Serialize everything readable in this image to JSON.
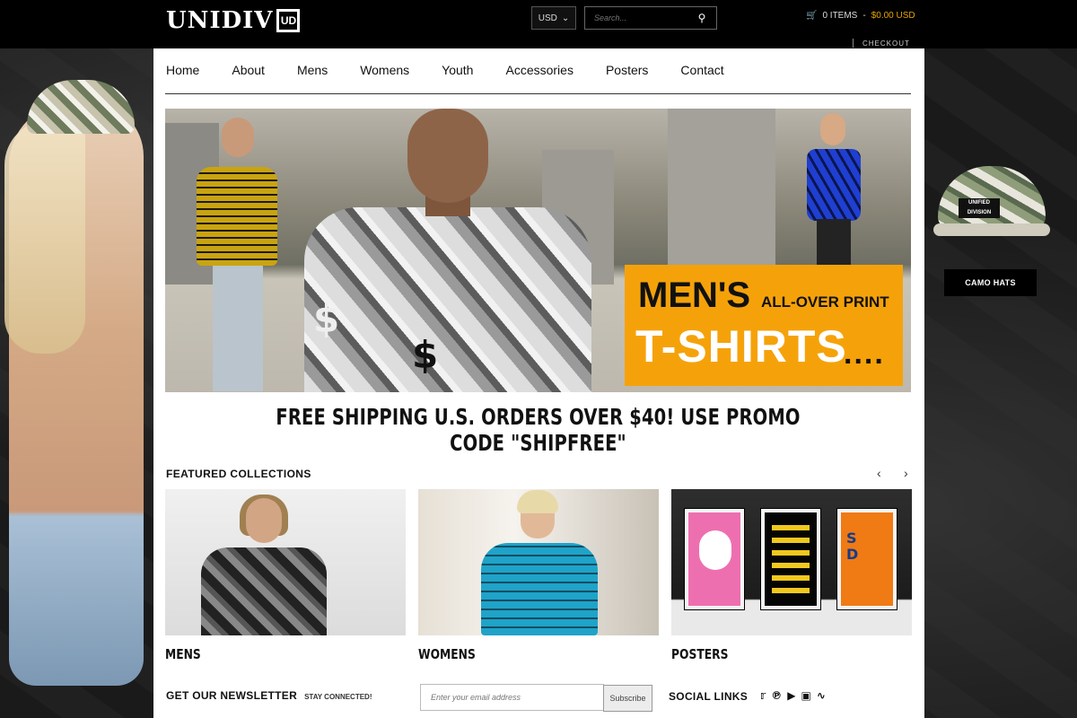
{
  "header": {
    "logo_text": "UNIDIV",
    "logo_mark": "UD",
    "currency": "USD",
    "search_placeholder": "Search...",
    "cart_items": "0 ITEMS",
    "cart_sep": "-",
    "cart_total": "$0.00 USD",
    "checkout": "CHECKOUT"
  },
  "nav": {
    "items": [
      "Home",
      "About",
      "Mens",
      "Womens",
      "Youth",
      "Accessories",
      "Posters",
      "Contact"
    ]
  },
  "hero": {
    "line1_big": "MEN'S",
    "line1_small": "ALL-OVER PRINT",
    "line2": "T-SHIRTS",
    "dots": "...."
  },
  "shipping_banner": "FREE SHIPPING U.S. ORDERS OVER $40! USE PROMO CODE \"SHIPFREE\"",
  "featured": {
    "title": "FEATURED COLLECTIONS",
    "prev_icon": "chevron-left-icon",
    "next_icon": "chevron-right-icon",
    "collections": [
      {
        "label": "MENS"
      },
      {
        "label": "WOMENS"
      },
      {
        "label": "POSTERS"
      }
    ]
  },
  "sidebar_right": {
    "hat_label": "UNIFIED DIVISION",
    "button": "CAMO HATS"
  },
  "newsletter": {
    "title": "GET OUR NEWSLETTER",
    "subtitle": "STAY CONNECTED!",
    "placeholder": "Enter your email address",
    "button": "Subscribe"
  },
  "social": {
    "title": "SOCIAL LINKS",
    "icons": [
      "twitter-icon",
      "pinterest-icon",
      "youtube-icon",
      "instagram-icon",
      "rss-icon"
    ]
  },
  "colors": {
    "accent": "#f5a20a",
    "cart_total": "#e8a300",
    "topbar": "#000000"
  }
}
